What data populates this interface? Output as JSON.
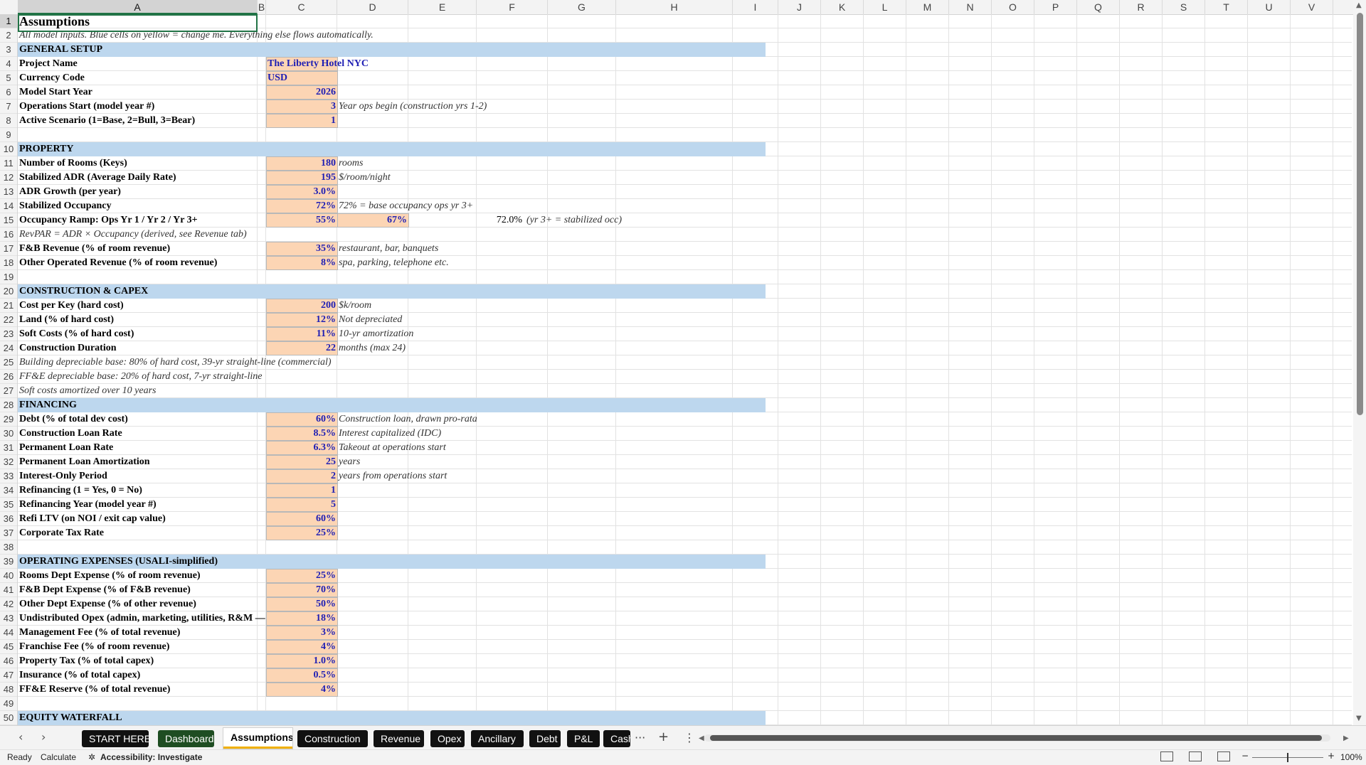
{
  "columns": [
    "A",
    "B",
    "C",
    "D",
    "E",
    "F",
    "G",
    "H",
    "I",
    "J",
    "K",
    "L",
    "M",
    "N",
    "O",
    "P",
    "Q",
    "R",
    "S",
    "T",
    "U",
    "V"
  ],
  "title": "Assumptions",
  "rows": [
    {
      "n": "1",
      "label": "Assumptions",
      "kind": "title"
    },
    {
      "n": "2",
      "label": "All model inputs. Blue cells on yellow = change me. Everything else flows automatically.",
      "kind": "note"
    },
    {
      "n": "3",
      "label": "GENERAL SETUP",
      "kind": "section"
    },
    {
      "n": "4",
      "label": "Project Name",
      "value": "The Liberty Hotel NYC",
      "kind": "input",
      "align": "left"
    },
    {
      "n": "5",
      "label": "Currency Code",
      "value": "USD",
      "kind": "input",
      "align": "left"
    },
    {
      "n": "6",
      "label": "Model Start Year",
      "value": "2026",
      "kind": "input"
    },
    {
      "n": "7",
      "label": "Operations Start (model year #)",
      "value": "3",
      "kind": "input",
      "note": "Year ops begin (construction yrs 1-2)"
    },
    {
      "n": "8",
      "label": "Active Scenario (1=Base, 2=Bull, 3=Bear)",
      "value": "1",
      "kind": "input"
    },
    {
      "n": "9",
      "label": "",
      "kind": "blank"
    },
    {
      "n": "10",
      "label": "PROPERTY",
      "kind": "section"
    },
    {
      "n": "11",
      "label": "Number of Rooms (Keys)",
      "value": "180",
      "kind": "input",
      "note": "rooms"
    },
    {
      "n": "12",
      "label": "Stabilized ADR (Average Daily Rate)",
      "value": "195",
      "kind": "input",
      "note": "$/room/night"
    },
    {
      "n": "13",
      "label": "ADR Growth (per year)",
      "value": "3.0%",
      "kind": "input"
    },
    {
      "n": "14",
      "label": "Stabilized Occupancy",
      "value": "72%",
      "kind": "input",
      "note": "72% = base occupancy ops yr 3+"
    },
    {
      "n": "15",
      "label": "Occupancy Ramp: Ops Yr 1 / Yr 2 / Yr 3+",
      "value": "55%",
      "value2": "67%",
      "value3": "72.0%",
      "note": "(yr 3+ = stabilized occ)",
      "kind": "ramp"
    },
    {
      "n": "16",
      "label": "RevPAR = ADR × Occupancy (derived, see Revenue tab)",
      "kind": "note"
    },
    {
      "n": "17",
      "label": "F&B Revenue (% of room revenue)",
      "value": "35%",
      "kind": "input",
      "note": "restaurant, bar, banquets"
    },
    {
      "n": "18",
      "label": "Other Operated Revenue (% of room revenue)",
      "value": "8%",
      "kind": "input",
      "note": "spa, parking, telephone etc."
    },
    {
      "n": "19",
      "label": "",
      "kind": "blank"
    },
    {
      "n": "20",
      "label": "CONSTRUCTION & CAPEX",
      "kind": "section"
    },
    {
      "n": "21",
      "label": "Cost per Key (hard cost)",
      "value": "200",
      "kind": "input",
      "note": "$k/room"
    },
    {
      "n": "22",
      "label": "Land (% of hard cost)",
      "value": "12%",
      "kind": "input",
      "note": "Not depreciated"
    },
    {
      "n": "23",
      "label": "Soft Costs (% of hard cost)",
      "value": "11%",
      "kind": "input",
      "note": "10-yr amortization"
    },
    {
      "n": "24",
      "label": "Construction Duration",
      "value": "22",
      "kind": "input",
      "note": "months (max 24)"
    },
    {
      "n": "25",
      "label": "Building depreciable base: 80% of hard cost, 39-yr straight-line (commercial)",
      "kind": "note"
    },
    {
      "n": "26",
      "label": "FF&E depreciable base: 20% of hard cost, 7-yr straight-line",
      "kind": "note"
    },
    {
      "n": "27",
      "label": "Soft costs amortized over 10 years",
      "kind": "note"
    },
    {
      "n": "28",
      "label": "FINANCING",
      "kind": "section"
    },
    {
      "n": "29",
      "label": "Debt (% of total dev cost)",
      "value": "60%",
      "kind": "input",
      "note": "Construction loan, drawn pro-rata"
    },
    {
      "n": "30",
      "label": "Construction Loan Rate",
      "value": "8.5%",
      "kind": "input",
      "note": "Interest capitalized (IDC)"
    },
    {
      "n": "31",
      "label": "Permanent Loan Rate",
      "value": "6.3%",
      "kind": "input",
      "note": "Takeout at operations start"
    },
    {
      "n": "32",
      "label": "Permanent Loan Amortization",
      "value": "25",
      "kind": "input",
      "note": "years"
    },
    {
      "n": "33",
      "label": "Interest-Only Period",
      "value": "2",
      "kind": "input",
      "note": "years from operations start"
    },
    {
      "n": "34",
      "label": "Refinancing (1 = Yes, 0 = No)",
      "value": "1",
      "kind": "input"
    },
    {
      "n": "35",
      "label": "Refinancing Year (model year #)",
      "value": "5",
      "kind": "input"
    },
    {
      "n": "36",
      "label": "Refi LTV (on NOI / exit cap value)",
      "value": "60%",
      "kind": "input"
    },
    {
      "n": "37",
      "label": "Corporate Tax Rate",
      "value": "25%",
      "kind": "input"
    },
    {
      "n": "38",
      "label": "",
      "kind": "blank"
    },
    {
      "n": "39",
      "label": "OPERATING EXPENSES (USALI-simplified)",
      "kind": "section"
    },
    {
      "n": "40",
      "label": "Rooms Dept Expense (% of room revenue)",
      "value": "25%",
      "kind": "input"
    },
    {
      "n": "41",
      "label": "F&B Dept Expense (% of F&B revenue)",
      "value": "70%",
      "kind": "input"
    },
    {
      "n": "42",
      "label": "Other Dept Expense (% of other revenue)",
      "value": "50%",
      "kind": "input"
    },
    {
      "n": "43",
      "label": "Undistributed Opex (admin, marketing, utilities, R&M —",
      "value": "18%",
      "kind": "input"
    },
    {
      "n": "44",
      "label": "Management Fee (% of total revenue)",
      "value": "3%",
      "kind": "input"
    },
    {
      "n": "45",
      "label": "Franchise Fee (% of room revenue)",
      "value": "4%",
      "kind": "input"
    },
    {
      "n": "46",
      "label": "Property Tax (% of total capex)",
      "value": "1.0%",
      "kind": "input"
    },
    {
      "n": "47",
      "label": "Insurance (% of total capex)",
      "value": "0.5%",
      "kind": "input"
    },
    {
      "n": "48",
      "label": "FF&E Reserve (% of total revenue)",
      "value": "4%",
      "kind": "input"
    },
    {
      "n": "49",
      "label": "",
      "kind": "blank"
    },
    {
      "n": "50",
      "label": "EQUITY WATERFALL",
      "kind": "section"
    }
  ],
  "tabs": [
    {
      "label": "START HERE",
      "style": "dark"
    },
    {
      "label": "Dashboard",
      "style": "green"
    },
    {
      "label": "Assumptions",
      "style": "active"
    },
    {
      "label": "Construction",
      "style": "dark"
    },
    {
      "label": "Revenue",
      "style": "dark"
    },
    {
      "label": "Opex",
      "style": "dark"
    },
    {
      "label": "Ancillary",
      "style": "dark"
    },
    {
      "label": "Debt",
      "style": "dark"
    },
    {
      "label": "P&L",
      "style": "dark"
    },
    {
      "label": "Cash",
      "style": "dark"
    }
  ],
  "tabbar": {
    "more": "···",
    "add": "+",
    "menu": "⋮",
    "prev": "‹",
    "next": "›"
  },
  "status": {
    "ready": "Ready",
    "calculate": "Calculate",
    "accessibility": "Accessibility: Investigate",
    "zoom": "100%"
  },
  "colors": {
    "section": "#bdd7ee",
    "input": "#fcd5b4",
    "input_text": "#1f1fb4",
    "select": "#217346"
  }
}
